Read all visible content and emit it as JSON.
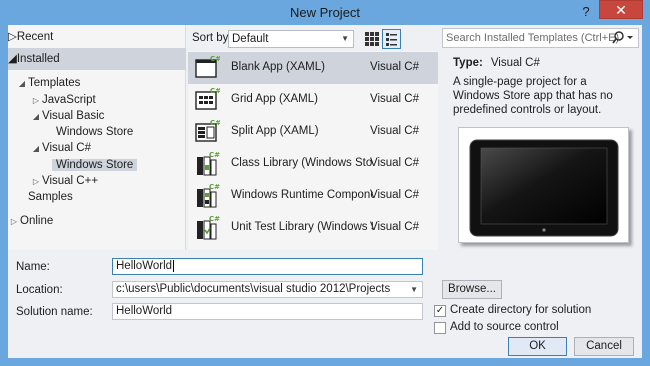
{
  "window": {
    "title": "New Project",
    "help_glyph": "?",
    "close_glyph": "✕"
  },
  "tree": {
    "recent": "Recent",
    "installed": "Installed",
    "templates": "Templates",
    "javascript": "JavaScript",
    "visual_basic": "Visual Basic",
    "vb_windows_store": "Windows Store",
    "visual_csharp": "Visual C#",
    "cs_windows_store": "Windows Store",
    "visual_cpp": "Visual C++",
    "samples": "Samples",
    "online": "Online"
  },
  "toolbar": {
    "sort_by_label": "Sort by:",
    "sort_value": "Default"
  },
  "templates": [
    {
      "name": "Blank App (XAML)",
      "language": "Visual C#",
      "icon": "blank-app-icon"
    },
    {
      "name": "Grid App (XAML)",
      "language": "Visual C#",
      "icon": "grid-app-icon"
    },
    {
      "name": "Split App (XAML)",
      "language": "Visual C#",
      "icon": "split-app-icon"
    },
    {
      "name": "Class Library (Windows Store...",
      "language": "Visual C#",
      "icon": "class-library-icon"
    },
    {
      "name": "Windows Runtime Component",
      "language": "Visual C#",
      "icon": "runtime-component-icon"
    },
    {
      "name": "Unit Test Library (Windows St...",
      "language": "Visual C#",
      "icon": "unit-test-icon"
    }
  ],
  "search": {
    "placeholder": "Search Installed Templates (Ctrl+E)"
  },
  "details": {
    "type_label": "Type:",
    "type_value": "Visual C#",
    "description": "A single-page project for a Windows Store app that has no predefined controls or layout."
  },
  "form": {
    "name_label": "Name:",
    "name_value": "HelloWorld",
    "location_label": "Location:",
    "location_value": "c:\\users\\Public\\documents\\visual studio 2012\\Projects",
    "solution_label": "Solution name:",
    "solution_value": "HelloWorld",
    "browse_label": "Browse...",
    "create_dir_label": "Create directory for solution",
    "create_dir_checked": true,
    "source_control_label": "Add to source control",
    "source_control_checked": false,
    "ok_label": "OK",
    "cancel_label": "Cancel"
  },
  "colors": {
    "window_frame": "#6aa7de",
    "close_button": "#c7463d",
    "selection": "#cfd3dc",
    "csharp_green": "#5a9e3a"
  }
}
